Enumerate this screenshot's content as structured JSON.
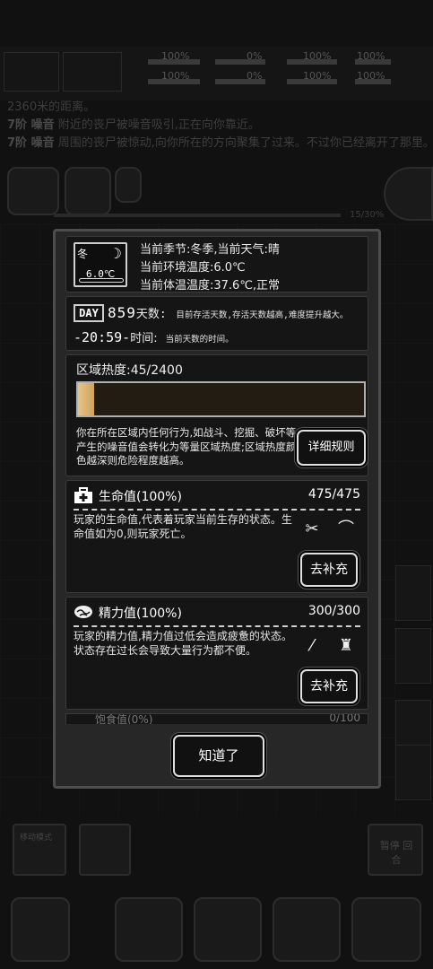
{
  "background": {
    "hud_percents": [
      "100%",
      "0%",
      "100%",
      "100%",
      "100%",
      "0%",
      "100%",
      "100%"
    ],
    "log_lines": [
      {
        "prefix": "",
        "text": "2360米的距离。"
      },
      {
        "prefix": "7阶 噪音",
        "text": "附近的丧尸被噪音吸引,正在向你靠近。"
      },
      {
        "prefix": "7阶 噪音",
        "text": "周围的丧尸被惊动,向你所在的方向聚集了过来。不过你已经离开了那里。"
      }
    ],
    "progress_text": "15/30%",
    "mode_button": "移动模式",
    "merge_button": "暂停 回合"
  },
  "weather": {
    "season_badge": "冬",
    "moon_icon": "moon-icon",
    "temp_badge": "6.0℃",
    "line1": "当前季节:冬季,当前天气:晴",
    "line2": "当前环境温度:6.0℃",
    "line3": "当前体温温度:37.6℃,正常"
  },
  "day": {
    "badge": "DAY",
    "number": "859",
    "days_label": "天数:",
    "days_desc": "目前存活天数,存活天数越高,难度提升越大。",
    "time_value": "-20:59-",
    "time_label": "时间:",
    "time_desc": "当前天数的时间。"
  },
  "heat": {
    "title": "区域热度:45/2400",
    "fill_fraction": 0.01875,
    "fill_color": "#d9ad6a",
    "description": "你在所在区域内任何行为,如战斗、挖掘、破坏等产生的噪音值会转化为等量区域热度;区域热度颜色越深则危险程度越高。",
    "rules_button": "详细规则"
  },
  "health": {
    "name": "生命值(100%)",
    "value": "475/475",
    "description": "玩家的生命值,代表着玩家当前生存的状态。生命值如为0,则玩家死亡。",
    "refill_button": "去补充",
    "icon": "medkit-icon"
  },
  "energy": {
    "name": "精力值(100%)",
    "value": "300/300",
    "description": "玩家的精力值,精力值过低会造成疲惫的状态。状态存在过长会导致大量行为都不便。",
    "refill_button": "去补充",
    "icon": "brain-icon"
  },
  "next_stat_peek": {
    "name": "饱食值(0%)",
    "value": "0/100"
  },
  "ok_button": "知道了"
}
